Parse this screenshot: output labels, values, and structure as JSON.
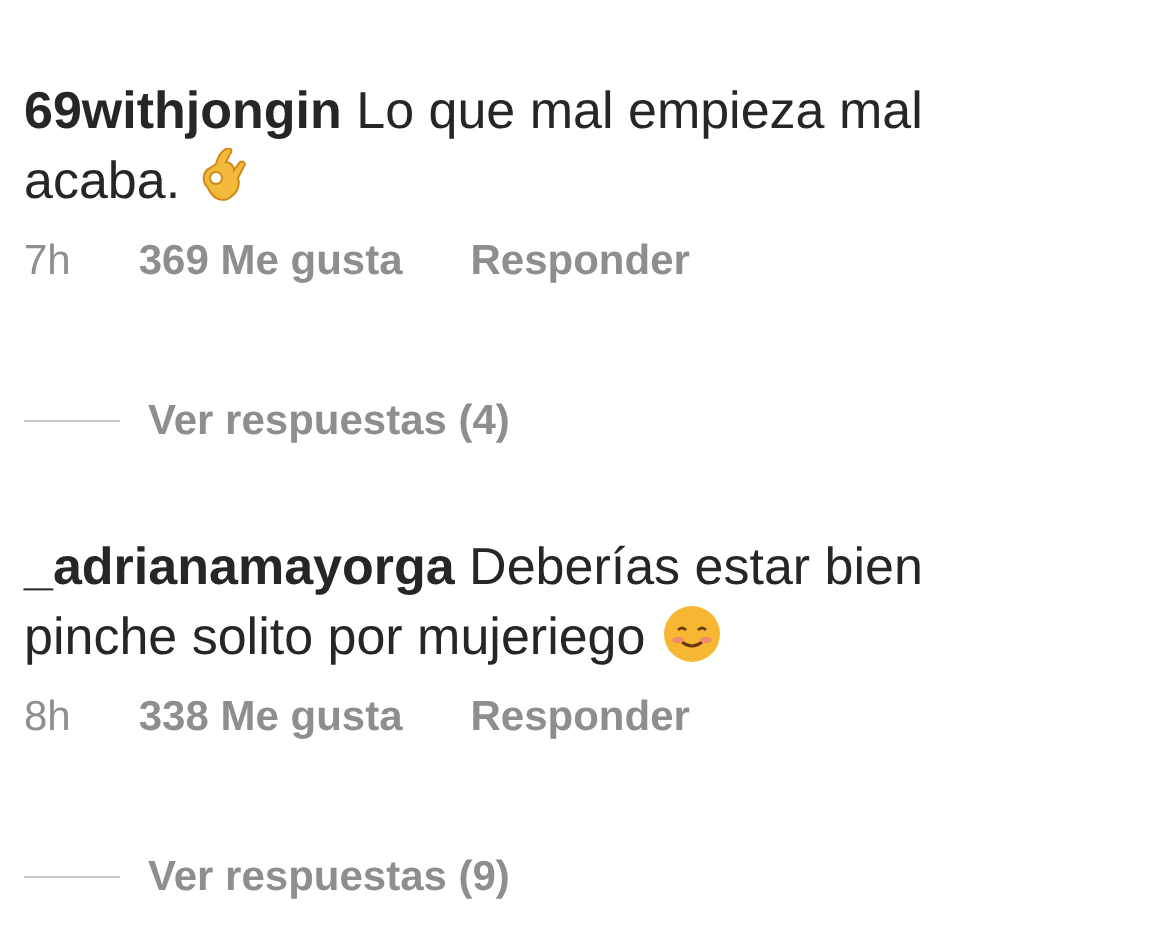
{
  "comments": [
    {
      "username": "69withjongin",
      "text": "Lo que mal empieza mal acaba.",
      "kind": "ok_hand",
      "time": "7h",
      "likes": "369 Me gusta",
      "reply": "Responder",
      "view_replies": "Ver respuestas (4)"
    },
    {
      "username": "_adrianamayorga",
      "text": "Deberías estar bien pinche solito por mujeriego",
      "kind": "smiling_face",
      "time": "8h",
      "likes": "338 Me gusta",
      "reply": "Responder",
      "view_replies": "Ver respuestas (9)"
    }
  ]
}
